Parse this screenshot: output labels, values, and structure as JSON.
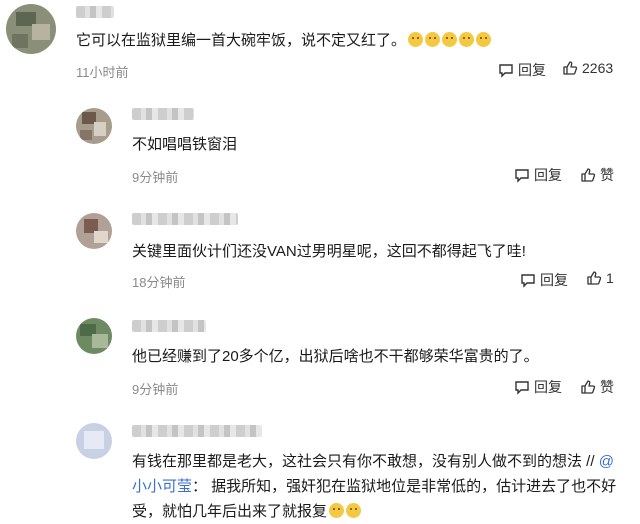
{
  "comments": [
    {
      "text": "它可以在监狱里编一首大碗牢饭，说不定又红了。",
      "emoji_count": 5,
      "time": "11小时前",
      "reply_label": "回复",
      "like_label": "2263",
      "avatar_color": "#7a8068"
    },
    {
      "text": "不如唱唱铁窗泪",
      "time": "9分钟前",
      "reply_label": "回复",
      "like_label": "赞",
      "avatar_color": "#a89c8c"
    },
    {
      "text": "关键里面伙计们还没VAN过男明星呢，这回不都得起飞了哇!",
      "time": "18分钟前",
      "reply_label": "回复",
      "like_label": "1",
      "avatar_color": "#b0a096"
    },
    {
      "text": "他已经赚到了20多个亿，出狱后啥也不干都够荣华富贵的了。",
      "time": "9分钟前",
      "reply_label": "回复",
      "like_label": "赞",
      "avatar_color": "#6e8a62"
    },
    {
      "text_before_mention": "有钱在那里都是老大，这社会只有你不敢想，没有别人做不到的想法 // ",
      "mention": "@小小可莹",
      "text_after_mention": "： 据我所知，强奸犯在监狱地位是非常低的，估计进去了也不好受，就怕几年后出来了就报复",
      "emoji_count": 2,
      "avatar_color": "#c8d0e4"
    }
  ]
}
